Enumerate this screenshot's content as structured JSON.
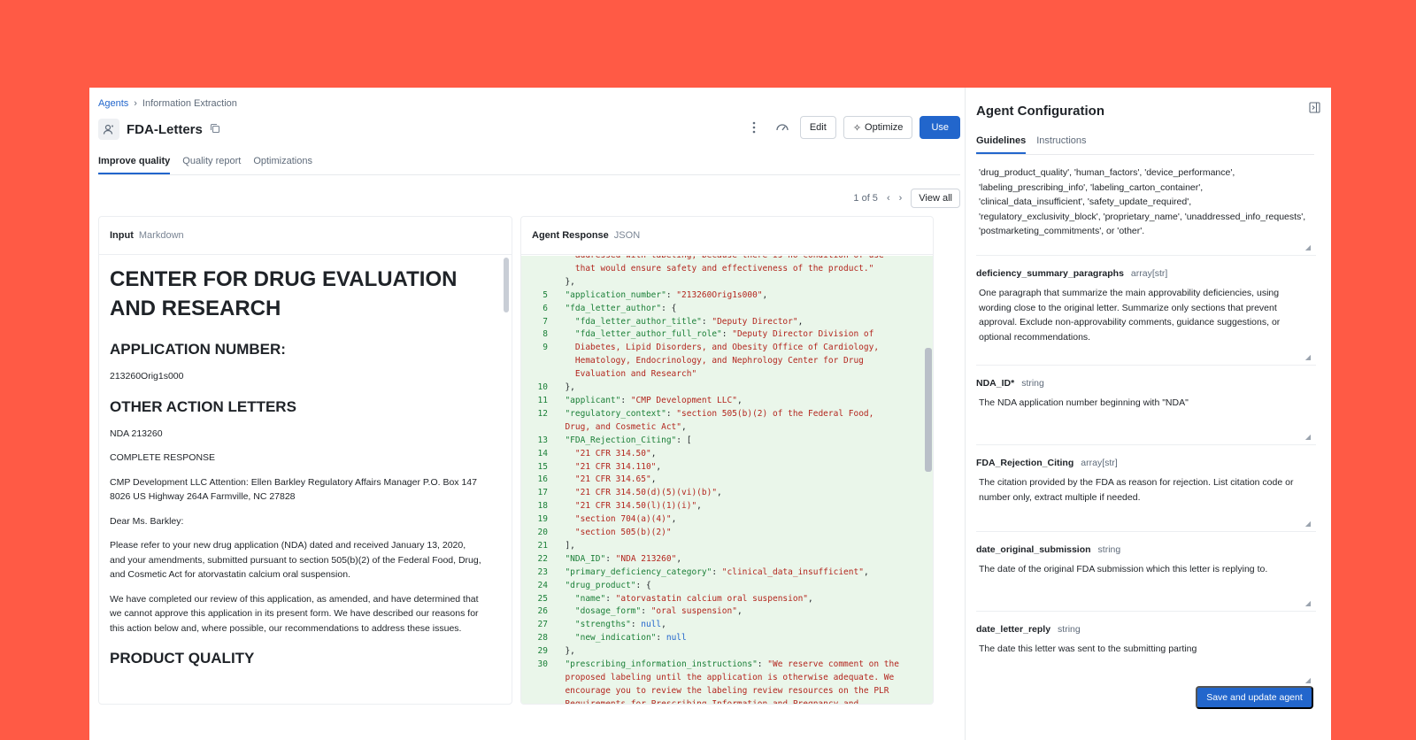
{
  "breadcrumb": {
    "root": "Agents",
    "separator": "›",
    "current": "Information Extraction"
  },
  "header": {
    "title": "FDA-Letters",
    "edit_label": "Edit",
    "optimize_label": "Optimize",
    "use_label": "Use"
  },
  "tabs": [
    {
      "label": "Improve quality"
    },
    {
      "label": "Quality report"
    },
    {
      "label": "Optimizations"
    }
  ],
  "pager": {
    "text": "1 of 5",
    "view_all": "View all"
  },
  "input_panel": {
    "title": "Input",
    "format": "Markdown",
    "h1": "CENTER FOR DRUG EVALUATION AND RESEARCH",
    "h2_app": "APPLICATION NUMBER:",
    "app_number": "213260Orig1s000",
    "h2_other": "OTHER ACTION LETTERS",
    "nda": "NDA 213260",
    "complete_response": "COMPLETE RESPONSE",
    "address": "CMP Development LLC Attention: Ellen Barkley Regulatory Affairs Manager P.O. Box 147 8026 US Highway 264A Farmville, NC 27828",
    "salutation": "Dear Ms. Barkley:",
    "para1": "Please refer to your new drug application (NDA) dated and received January 13, 2020, and your amendments, submitted pursuant to section 505(b)(2) of the Federal Food, Drug, and Cosmetic Act for atorvastatin calcium oral suspension.",
    "para2": "We have completed our review of this application, as amended, and have determined that we cannot approve this application in its present form. We have described our reasons for this action below and, where possible, our recommendations to address these issues.",
    "h2_quality": "PRODUCT QUALITY"
  },
  "response_panel": {
    "title": "Agent Response",
    "format": "JSON",
    "lines": [
      {
        "n": "",
        "p": [
          "    ",
          {
            "s": "addressed with labeling, because there is no condition of use"
          }
        ]
      },
      {
        "n": "",
        "p": [
          "    ",
          {
            "s": "that would ensure safety and effectiveness of the product.\""
          }
        ]
      },
      {
        "n": "",
        "p": [
          "  },"
        ]
      },
      {
        "n": "5",
        "p": [
          "  ",
          {
            "k": "\"application_number\""
          },
          ": ",
          {
            "s": "\"213260Orig1s000\""
          },
          ","
        ]
      },
      {
        "n": "6",
        "p": [
          "  ",
          {
            "k": "\"fda_letter_author\""
          },
          ": {"
        ]
      },
      {
        "n": "7",
        "p": [
          "    ",
          {
            "k": "\"fda_letter_author_title\""
          },
          ": ",
          {
            "s": "\"Deputy Director\""
          },
          ","
        ]
      },
      {
        "n": "8",
        "p": [
          "    ",
          {
            "k": "\"fda_letter_author_full_role\""
          },
          ": ",
          {
            "s": "\"Deputy Director Division of"
          }
        ]
      },
      {
        "n": "9",
        "p": [
          "    ",
          {
            "s": "Diabetes, Lipid Disorders, and Obesity Office of Cardiology,"
          }
        ]
      },
      {
        "n": "",
        "p": [
          "    ",
          {
            "s": "Hematology, Endocrinology, and Nephrology Center for Drug"
          }
        ]
      },
      {
        "n": "",
        "p": [
          "    ",
          {
            "s": "Evaluation and Research\""
          }
        ]
      },
      {
        "n": "10",
        "p": [
          "  },"
        ]
      },
      {
        "n": "11",
        "p": [
          "  ",
          {
            "k": "\"applicant\""
          },
          ": ",
          {
            "s": "\"CMP Development LLC\""
          },
          ","
        ]
      },
      {
        "n": "12",
        "p": [
          "  ",
          {
            "k": "\"regulatory_context\""
          },
          ": ",
          {
            "s": "\"section 505(b)(2) of the Federal Food,"
          }
        ]
      },
      {
        "n": "",
        "p": [
          "  ",
          {
            "s": "Drug, and Cosmetic Act\""
          },
          ","
        ]
      },
      {
        "n": "13",
        "p": [
          "  ",
          {
            "k": "\"FDA_Rejection_Citing\""
          },
          ": ["
        ]
      },
      {
        "n": "14",
        "p": [
          "    ",
          {
            "s": "\"21 CFR 314.50\""
          },
          ","
        ]
      },
      {
        "n": "15",
        "p": [
          "    ",
          {
            "s": "\"21 CFR 314.110\""
          },
          ","
        ]
      },
      {
        "n": "16",
        "p": [
          "    ",
          {
            "s": "\"21 CFR 314.65\""
          },
          ","
        ]
      },
      {
        "n": "17",
        "p": [
          "    ",
          {
            "s": "\"21 CFR 314.50(d)(5)(vi)(b)\""
          },
          ","
        ]
      },
      {
        "n": "18",
        "p": [
          "    ",
          {
            "s": "\"21 CFR 314.50(l)(1)(i)\""
          },
          ","
        ]
      },
      {
        "n": "19",
        "p": [
          "    ",
          {
            "s": "\"section 704(a)(4)\""
          },
          ","
        ]
      },
      {
        "n": "20",
        "p": [
          "    ",
          {
            "s": "\"section 505(b)(2)\""
          }
        ]
      },
      {
        "n": "21",
        "p": [
          "  ],"
        ]
      },
      {
        "n": "22",
        "p": [
          "  ",
          {
            "k": "\"NDA_ID\""
          },
          ": ",
          {
            "s": "\"NDA 213260\""
          },
          ","
        ]
      },
      {
        "n": "23",
        "p": [
          "  ",
          {
            "k": "\"primary_deficiency_category\""
          },
          ": ",
          {
            "s": "\"clinical_data_insufficient\""
          },
          ","
        ]
      },
      {
        "n": "24",
        "p": [
          "  ",
          {
            "k": "\"drug_product\""
          },
          ": {"
        ]
      },
      {
        "n": "25",
        "p": [
          "    ",
          {
            "k": "\"name\""
          },
          ": ",
          {
            "s": "\"atorvastatin calcium oral suspension\""
          },
          ","
        ]
      },
      {
        "n": "26",
        "p": [
          "    ",
          {
            "k": "\"dosage_form\""
          },
          ": ",
          {
            "s": "\"oral suspension\""
          },
          ","
        ]
      },
      {
        "n": "27",
        "p": [
          "    ",
          {
            "k": "\"strengths\""
          },
          ": ",
          {
            "kw": "null"
          },
          ","
        ]
      },
      {
        "n": "28",
        "p": [
          "    ",
          {
            "k": "\"new_indication\""
          },
          ": ",
          {
            "kw": "null"
          }
        ]
      },
      {
        "n": "29",
        "p": [
          "  },"
        ]
      },
      {
        "n": "30",
        "p": [
          "  ",
          {
            "k": "\"prescribing_information_instructions\""
          },
          ": ",
          {
            "s": "\"We reserve comment on the"
          }
        ]
      },
      {
        "n": "",
        "p": [
          "  ",
          {
            "s": "proposed labeling until the application is otherwise adequate. We"
          }
        ]
      },
      {
        "n": "",
        "p": [
          "  ",
          {
            "s": "encourage you to review the labeling review resources on the PLR"
          }
        ]
      },
      {
        "n": "",
        "p": [
          "  ",
          {
            "s": "Requirements for Prescribing Information and Pregnancy and"
          }
        ]
      }
    ]
  },
  "config": {
    "title": "Agent Configuration",
    "tabs": [
      {
        "label": "Guidelines"
      },
      {
        "label": "Instructions"
      }
    ],
    "fields": [
      {
        "name": "",
        "type": "",
        "desc": "'drug_product_quality', 'human_factors', 'device_performance', 'labeling_prescribing_info', 'labeling_carton_container', 'clinical_data_insufficient', 'safety_update_required', 'regulatory_exclusivity_block', 'proprietary_name', 'unaddressed_info_requests', 'postmarketing_commitments', or 'other'."
      },
      {
        "name": "deficiency_summary_paragraphs",
        "type": "array[str]",
        "desc": "One paragraph that summarize the main approvability deficiencies, using wording close to the original letter. Summarize only sections that prevent approval. Exclude non-approvability comments, guidance suggestions, or optional recommendations."
      },
      {
        "name": "NDA_ID*",
        "type": "string",
        "desc": "The NDA application number beginning with \"NDA\""
      },
      {
        "name": "FDA_Rejection_Citing",
        "type": "array[str]",
        "desc": "The citation provided by the FDA as reason for rejection. List citation code or number only, extract multiple if needed."
      },
      {
        "name": "date_original_submission",
        "type": "string",
        "desc": "The date of the original FDA submission which this letter is replying to."
      },
      {
        "name": "date_letter_reply",
        "type": "string",
        "desc": "The date this letter was sent to the submitting parting"
      }
    ],
    "save_label": "Save and update agent"
  }
}
